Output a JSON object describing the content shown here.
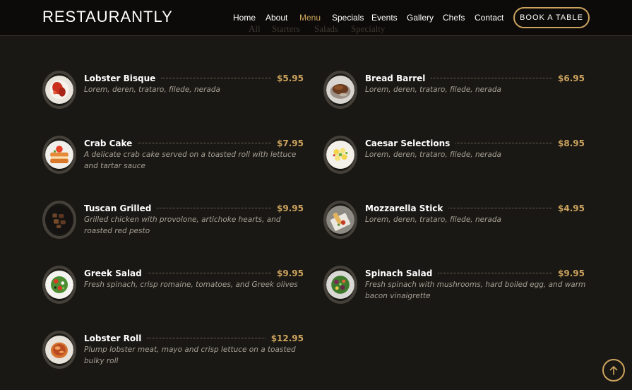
{
  "brand": "RESTAURANTLY",
  "nav": [
    "Home",
    "About",
    "Menu",
    "Specials",
    "Events",
    "Gallery",
    "Chefs",
    "Contact"
  ],
  "active_nav": "Menu",
  "cta": "BOOK A TABLE",
  "filters": [
    "All",
    "Starters",
    "Salads",
    "Specialty"
  ],
  "menu_items": [
    {
      "name": "Lobster Bisque",
      "price": "$5.95",
      "description": "Lorem, deren, trataro, filede, nerada",
      "icon": "lobster-bisque-dish"
    },
    {
      "name": "Bread Barrel",
      "price": "$6.95",
      "description": "Lorem, deren, trataro, filede, nerada",
      "icon": "bread-barrel-dish"
    },
    {
      "name": "Crab Cake",
      "price": "$7.95",
      "description": "A delicate crab cake served on a toasted roll with lettuce and tartar sauce",
      "icon": "crab-cake-dish"
    },
    {
      "name": "Caesar Selections",
      "price": "$8.95",
      "description": "Lorem, deren, trataro, filede, nerada",
      "icon": "caesar-salad-dish"
    },
    {
      "name": "Tuscan Grilled",
      "price": "$9.95",
      "description": "Grilled chicken with provolone, artichoke hearts, and roasted red pesto",
      "icon": "tuscan-grilled-dish"
    },
    {
      "name": "Mozzarella Stick",
      "price": "$4.95",
      "description": "Lorem, deren, trataro, filede, nerada",
      "icon": "mozzarella-stick-dish"
    },
    {
      "name": "Greek Salad",
      "price": "$9.95",
      "description": "Fresh spinach, crisp romaine, tomatoes, and Greek olives",
      "icon": "greek-salad-dish"
    },
    {
      "name": "Spinach Salad",
      "price": "$9.95",
      "description": "Fresh spinach with mushrooms, hard boiled egg, and warm bacon vinaigrette",
      "icon": "spinach-salad-dish"
    },
    {
      "name": "Lobster Roll",
      "price": "$12.95",
      "description": "Plump lobster meat, mayo and crisp lettuce on a toasted bulky roll",
      "icon": "lobster-roll-dish"
    }
  ],
  "scroll_top_icon": "arrow-up-icon",
  "colors": {
    "accent": "#cda45e",
    "background": "#1a1814",
    "header": "#0c0b09"
  }
}
